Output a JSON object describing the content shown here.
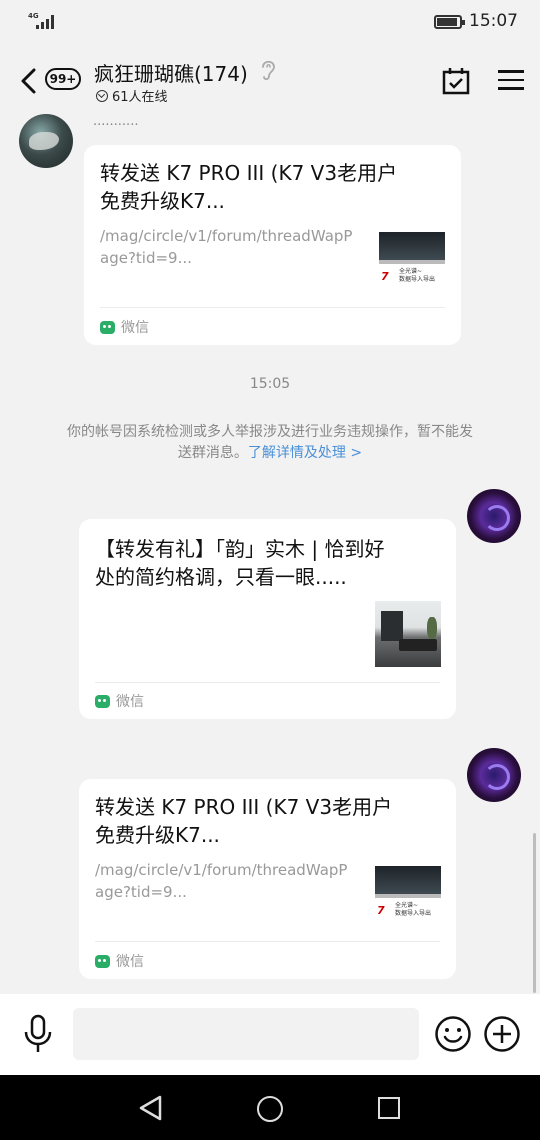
{
  "status_bar": {
    "network": "4G",
    "time": "15:07"
  },
  "header": {
    "unread_badge": "99+",
    "group_title": "疯狂珊瑚礁(174)",
    "online_count": "61人在线"
  },
  "messages": {
    "sender_name": "...........",
    "card1": {
      "title_line1": "转发送 K7 PRO III (K7 V3老用户",
      "title_line2": "免费升级K7...",
      "desc_line1": "/mag/circle/v1/forum/threadWapP",
      "desc_line2": "age?tid=9...",
      "thumb_caption_line1": "全光谱~",
      "thumb_caption_line2": "数据导入导出",
      "thumb_logo": "7",
      "source": "微信"
    },
    "timestamp": "15:05",
    "system_notice_line1": "你的帐号因系统检测或多人举报涉及进行业务违规操作，暂不能发",
    "system_notice_line2": "送群消息。",
    "system_notice_link": "了解详情及处理 >",
    "card2": {
      "title_line1": "【转发有礼】「韵」实木 | 恰到好",
      "title_line2": "处的简约格调，只看一眼.....",
      "source": "微信"
    },
    "card3": {
      "title_line1": "转发送 K7 PRO III (K7 V3老用户",
      "title_line2": "免费升级K7...",
      "desc_line1": "/mag/circle/v1/forum/threadWapP",
      "desc_line2": "age?tid=9...",
      "thumb_caption_line1": "全光谱~",
      "thumb_caption_line2": "数据导入导出",
      "thumb_logo": "7",
      "source": "微信"
    }
  }
}
